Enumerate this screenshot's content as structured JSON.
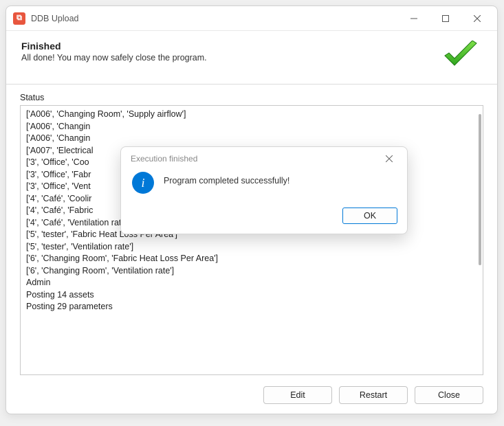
{
  "window": {
    "title": "DDB Upload",
    "header_title": "Finished",
    "header_subtitle": "All done! You may now safely close the program."
  },
  "status": {
    "label": "Status",
    "lines": [
      "['A006', 'Changing Room', 'Supply airflow']",
      "['A006', 'Changin",
      "['A006', 'Changin",
      "['A007', 'Electrical",
      "['3', 'Office', 'Coo",
      "['3', 'Office', 'Fabr",
      "['3', 'Office', 'Vent",
      "['4', 'Café', 'Coolir",
      "['4', 'Café', 'Fabric",
      "['4', 'Café', 'Ventilation rate']",
      "['5', 'tester', 'Fabric Heat Loss Per Area']",
      "['5', 'tester', 'Ventilation rate']",
      "['6', 'Changing Room', 'Fabric Heat Loss Per Area']",
      "['6', 'Changing Room', 'Ventilation rate']",
      "Admin",
      "Posting 14 assets",
      "Posting 29 parameters"
    ]
  },
  "footer": {
    "edit": "Edit",
    "restart": "Restart",
    "close": "Close"
  },
  "dialog": {
    "title": "Execution finished",
    "message": "Program completed successfully!",
    "ok": "OK"
  }
}
